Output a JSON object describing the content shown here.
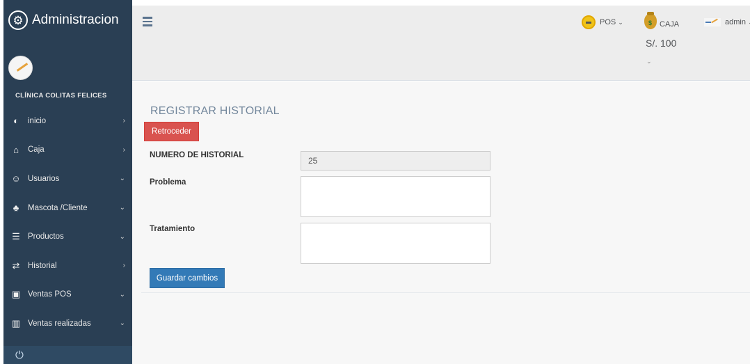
{
  "sidebar": {
    "title": "Administracion",
    "clinic_name": "CLÍNICA COLITAS FELICES",
    "items": [
      {
        "label": "inicio",
        "icon": "dashboard-icon",
        "arrow": "›"
      },
      {
        "label": "Caja",
        "icon": "bank-icon",
        "arrow": "›"
      },
      {
        "label": "Usuarios",
        "icon": "users-icon",
        "arrow": "⌄"
      },
      {
        "label": "Mascota /Cliente",
        "icon": "paw-icon",
        "arrow": "⌄"
      },
      {
        "label": "Productos",
        "icon": "database-icon",
        "arrow": "⌄"
      },
      {
        "label": "Historial",
        "icon": "history-icon",
        "arrow": "›"
      },
      {
        "label": "Ventas POS",
        "icon": "money-icon",
        "arrow": "⌄"
      },
      {
        "label": "Ventas realizadas",
        "icon": "bar-chart-icon",
        "arrow": "⌄"
      }
    ]
  },
  "topnav": {
    "pos_label": "POS",
    "caja_label": "CAJA",
    "caja_amount": "S/. 100",
    "admin_label": "admin"
  },
  "form": {
    "title": "REGISTRAR HISTORIAL",
    "back_button": "Retroceder",
    "historial_number_label": "NUMERO DE HISTORIAL",
    "historial_number_value": "25",
    "problema_label": "Problema",
    "problema_value": "",
    "tratamiento_label": "Tratamiento",
    "tratamiento_value": "",
    "save_button": "Guardar cambios"
  },
  "colors": {
    "sidebar_bg": "#2a3f54",
    "danger": "#d9534f",
    "primary": "#337ab7",
    "topnav_bg": "#ededed"
  }
}
